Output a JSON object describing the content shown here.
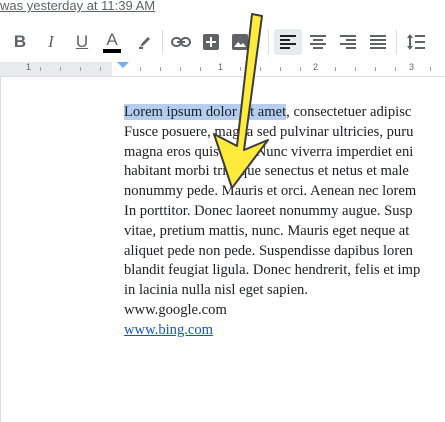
{
  "header": {
    "last_edit": "was yesterday at 11:39 AM"
  },
  "toolbar": {
    "bold": "B",
    "italic": "I",
    "underline": "U",
    "text_color": "A",
    "text_color_value": "#000000",
    "icons": [
      "highlighter-icon",
      "link-icon",
      "insert-comment-icon",
      "insert-image-icon",
      "align-left-icon",
      "align-center-icon",
      "align-right-icon",
      "align-justify-icon",
      "line-spacing-icon"
    ]
  },
  "ruler": {
    "numbers": [
      "1",
      "1",
      "2",
      "3"
    ]
  },
  "document": {
    "highlighted": "Lorem ipsum dolor sit amet",
    "first_line_rest": ", consectetuer adipisc",
    "lines": [
      "Fusce posuere, magna sed pulvinar ultricies, puru",
      "magna eros quis urna. Nunc viverra imperdiet eni",
      "habitant morbi tristique senectus et netus et male",
      "nonummy pede. Mauris et orci. Aenean nec lorem",
      "In porttitor. Donec laoreet nonummy augue. Susp",
      "vitae, pretium mattis, nunc. Mauris eget neque at",
      "aliquet pede non pede. Suspendisse dapibus loren",
      "blandit feugiat ligula. Donec hendrerit, felis et imp",
      "in lacinia nulla nisl eget sapien.",
      "www.google.com"
    ],
    "link": "www.bing.com"
  },
  "colors": {
    "highlight": "#b4cdf0",
    "arrow": "#ffeb3b",
    "link": "#1155cc"
  }
}
